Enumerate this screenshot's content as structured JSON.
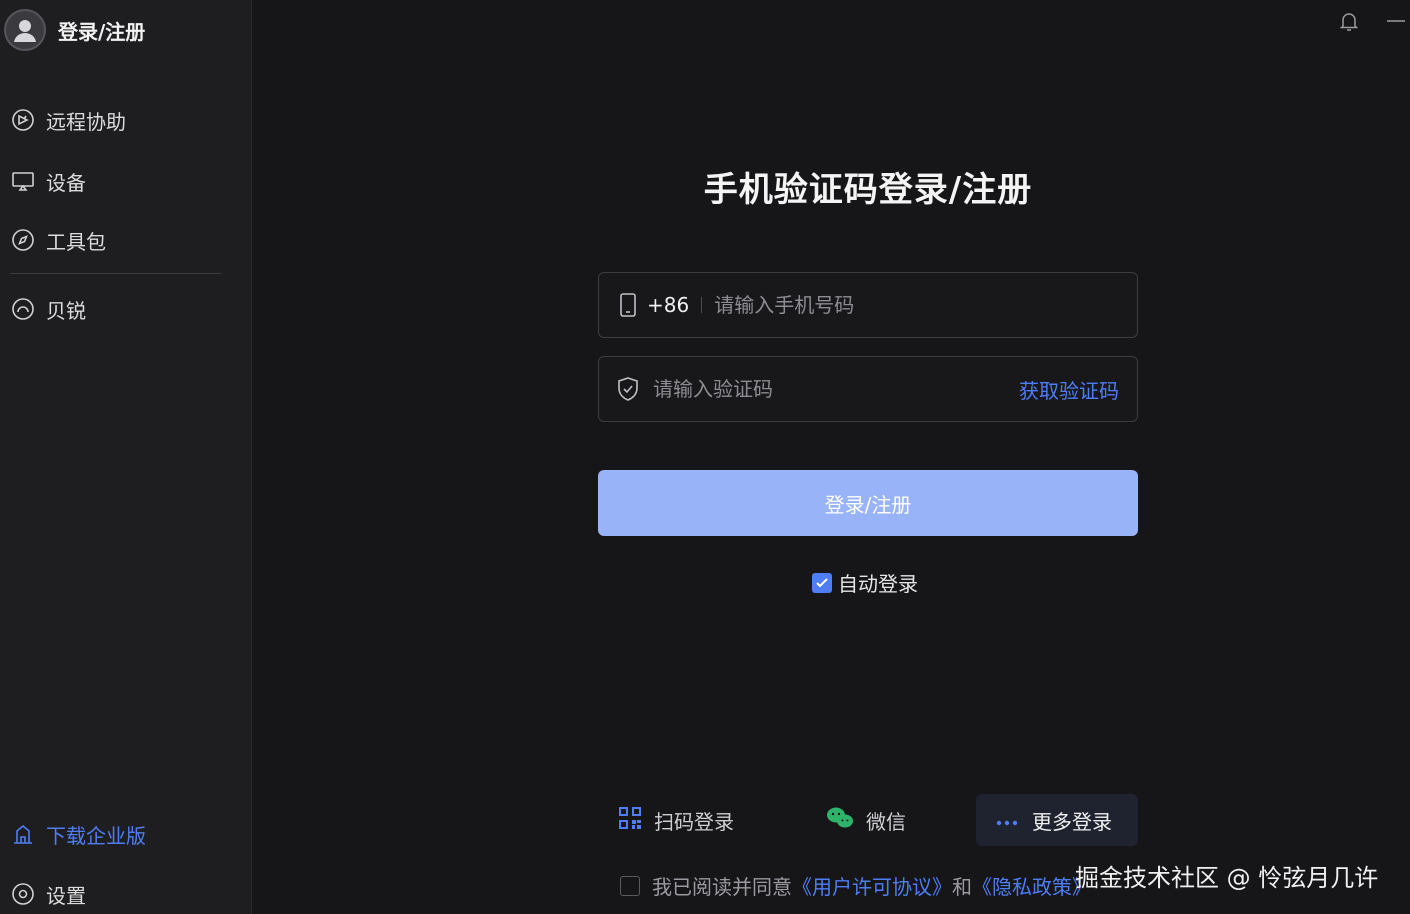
{
  "sidebar": {
    "user_label": "登录/注册",
    "items": [
      {
        "label": "远程协助",
        "icon": "remote-assist-icon"
      },
      {
        "label": "设备",
        "icon": "monitor-icon"
      },
      {
        "label": "工具包",
        "icon": "compass-icon"
      },
      {
        "label": "贝锐",
        "icon": "oray-icon"
      }
    ],
    "download_label": "下载企业版",
    "settings_label": "设置"
  },
  "main": {
    "title": "手机验证码登录/注册",
    "phone": {
      "prefix": "+86",
      "placeholder": "请输入手机号码"
    },
    "code": {
      "placeholder": "请输入验证码",
      "get_code_label": "获取验证码"
    },
    "login_button": "登录/注册",
    "auto_login": {
      "label": "自动登录",
      "checked": true
    },
    "options": {
      "qr_label": "扫码登录",
      "wechat_label": "微信",
      "more_label": "更多登录"
    },
    "agreement": {
      "prefix": "我已阅读并同意",
      "license": "《用户许可协议》",
      "and": "和",
      "privacy": "《隐私政策》"
    }
  },
  "watermark": "掘金技术社区 @ 怜弦月几许",
  "colors": {
    "accent": "#4f7df5",
    "button": "#98b3f7",
    "background": "#161619",
    "sidebar": "#1e1e21"
  }
}
